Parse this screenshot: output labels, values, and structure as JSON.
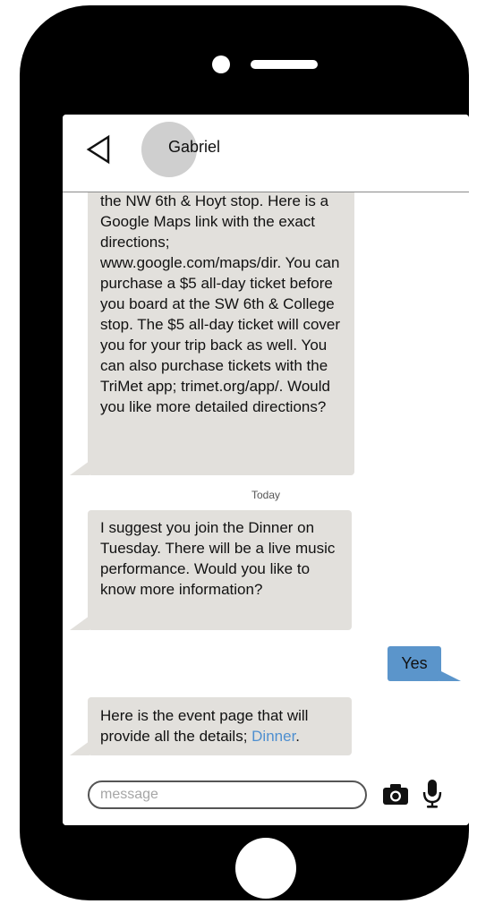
{
  "header": {
    "contact_name": "Gabriel",
    "back_icon": "back-triangle-icon"
  },
  "messages": [
    {
      "direction": "incoming",
      "text": "the NW 6th & Hoyt stop. Here is a Google Maps link with the exact directions; www.google.com/maps/dir. You can purchase a $5 all-day ticket before you board at the SW 6th & College stop. The $5 all-day ticket will cover you for your trip back as well. You can also purchase tickets with the TriMet app; trimet.org/app/. Would you like more detailed directions?"
    },
    {
      "direction": "incoming",
      "text": "I suggest you join the Dinner on Tuesday. There will be a live music performance. Would you like to know more information?"
    },
    {
      "direction": "outgoing",
      "text": "Yes"
    },
    {
      "direction": "incoming",
      "text": "Here is the event page that will provide all the details; ",
      "link_text": "Dinner",
      "trailing_text": "."
    }
  ],
  "timestamp": "Today",
  "input": {
    "placeholder": "message",
    "value": ""
  },
  "icons": {
    "camera": "camera-icon",
    "mic": "microphone-icon"
  },
  "colors": {
    "incoming_bubble": "#e2e0dc",
    "outgoing_bubble": "#5b95cb",
    "link": "#4e8fd0",
    "phone_body": "#000000"
  }
}
